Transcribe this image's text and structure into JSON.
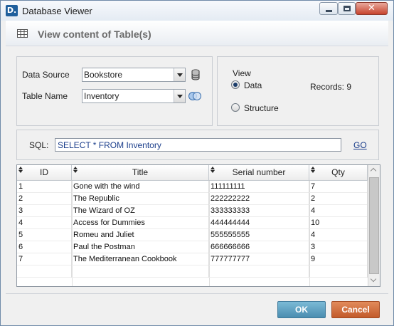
{
  "window": {
    "title": "Database Viewer",
    "app_icon_text": "D.",
    "close_glyph": "✕"
  },
  "header": {
    "title": "View content of Table(s)"
  },
  "source_panel": {
    "data_source_label": "Data Source",
    "data_source_value": "Bookstore",
    "table_name_label": "Table Name",
    "table_name_value": "Inventory"
  },
  "view_panel": {
    "label": "View",
    "options": [
      {
        "label": "Data",
        "selected": true
      },
      {
        "label": "Structure",
        "selected": false
      }
    ],
    "records_text": "Records: 9"
  },
  "sql": {
    "label": "SQL:",
    "query": "SELECT * FROM Inventory",
    "go_label": "GO"
  },
  "grid": {
    "columns": [
      "ID",
      "Title",
      "Serial number",
      "Qty"
    ],
    "rows": [
      [
        "1",
        "Gone with the wind",
        "111111111",
        "7"
      ],
      [
        "2",
        "The Republic",
        "222222222",
        "2"
      ],
      [
        "3",
        "The Wizard of OZ",
        "333333333",
        "4"
      ],
      [
        "4",
        "Access for Dummies",
        "444444444",
        "10"
      ],
      [
        "5",
        "Romeu and Juliet",
        "555555555",
        "4"
      ],
      [
        "6",
        "Paul the Postman",
        "666666666",
        "3"
      ],
      [
        "7",
        "The Mediterranean Cookbook",
        "777777777",
        "9"
      ]
    ]
  },
  "buttons": {
    "ok": "OK",
    "cancel": "Cancel"
  },
  "colors": {
    "ok_button": "#5a9fc2",
    "cancel_button": "#d2703f",
    "link": "#1c3f8c"
  }
}
